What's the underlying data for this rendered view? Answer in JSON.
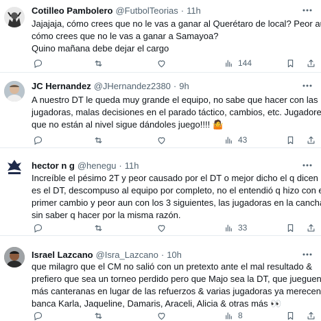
{
  "tweets": [
    {
      "name": "Cotilleo Pambolero",
      "handle": "@FutbolTeorias",
      "sep": "·",
      "time": "11h",
      "lines": [
        "Jajajaja, cómo crees que no le vas a ganar al Querétaro de local? Peor aun,",
        "cómo crees que no le vas a ganar a Samayoa?",
        "Quino mañana debe dejar el cargo"
      ],
      "views": "144"
    },
    {
      "name": "JC Hernandez",
      "handle": "@JHernandez2380",
      "sep": "·",
      "time": "9h",
      "lines": [
        "A nuestro DT le queda muy grande el equipo, no sabe que hacer con las",
        "jugadoras, malas decisiones en el parado táctico, cambios, etc. Jugadores",
        "que no están al nivel sigue dándoles juego!!!! 🤷"
      ],
      "views": "43"
    },
    {
      "name": "hector n g",
      "handle": "@henegu",
      "sep": "·",
      "time": "11h",
      "lines": [
        "Increíble el pésimo 2T y peor causado por el DT o mejor dicho el q dicen q",
        "es el DT, descompuso al equipo por completo, no el entendió q hizo con el",
        "primer cambio y peor aun con los 3 siguientes, las jugadoras en la cancha",
        "sin saber q hacer por la misma razón."
      ],
      "views": "33"
    },
    {
      "name": "Israel Lazcano",
      "handle": "@Isra_Lazcano",
      "sep": "·",
      "time": "10h",
      "lines": [
        "que milagro que el CM no salió con un pretexto ante el mal resultado &",
        "prefiero que sea un torneo perdido pero que Majo sea la DT, que jueguen",
        "más canteranas en lugar de las refuerzos & varias jugadoras ya merecen",
        "banca Karla, Jaqueline, Damaris, Araceli, Alicia & otras más 👀"
      ],
      "views": "8"
    }
  ],
  "icons": {
    "more": "more-horizontal-icon",
    "reply": "reply-bubble-icon",
    "retweet": "retweet-icon",
    "like": "heart-icon",
    "views": "analytics-bars-icon",
    "bookmark": "bookmark-icon",
    "share": "share-upload-icon"
  },
  "colors": {
    "text": "#0f1419",
    "secondary": "#536471",
    "divider": "#e6ecf0"
  }
}
